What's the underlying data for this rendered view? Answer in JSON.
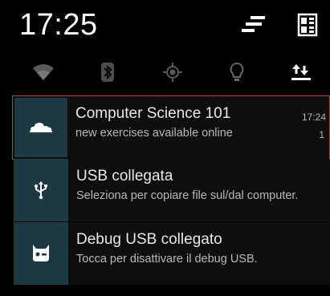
{
  "status_header": {
    "time": "17:25",
    "settings_icon": "sliders-icon",
    "profile_icon": "profile-grid-icon"
  },
  "quick_settings": [
    {
      "name": "wifi",
      "icon": "wifi-icon"
    },
    {
      "name": "bluetooth",
      "icon": "bluetooth-icon"
    },
    {
      "name": "location",
      "icon": "location-icon"
    },
    {
      "name": "flashlight",
      "icon": "lightbulb-icon"
    },
    {
      "name": "sync",
      "icon": "sync-arrows-icon"
    }
  ],
  "notifications": [
    {
      "title": "Computer Science 101",
      "text": "new exercises available online",
      "time": "17:24",
      "count": "1",
      "icon": "cloud-icon",
      "selected": true
    },
    {
      "title": "USB collegata",
      "text": "Seleziona per copiare file sul/dal computer.",
      "icon": "usb-icon"
    },
    {
      "title": "Debug USB collegato",
      "text": "Tocca per disattivare il debug USB.",
      "icon": "cyanogenmod-bug-icon"
    }
  ],
  "colors": {
    "background": "#000000",
    "icon_tile": "#1d3943",
    "selection_border": "#b3483c"
  }
}
